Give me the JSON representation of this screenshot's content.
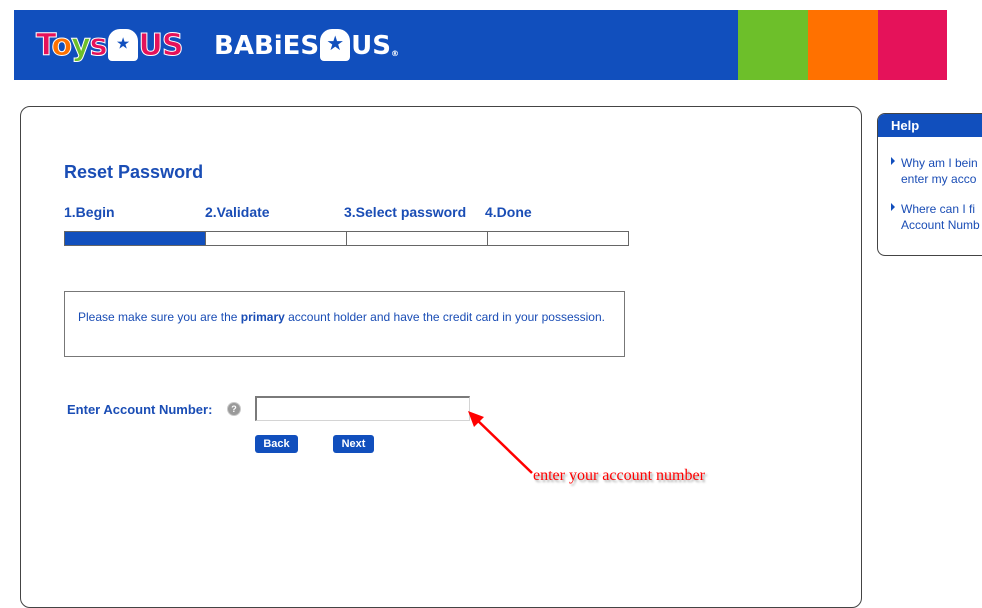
{
  "brand": {
    "toys_logo": {
      "letters": [
        "T",
        "o",
        "y",
        "s"
      ],
      "colors": [
        "#e5125a",
        "#ff7100",
        "#6dbf2a",
        "#e5125a"
      ],
      "r_mark": "★",
      "us": "US",
      "us_color": "#e5125a"
    },
    "babies_logo": {
      "text": "BABiES",
      "r_mark": "★",
      "us": "US",
      "trademark": "®"
    },
    "colors": {
      "primary_blue": "#114fbd",
      "green": "#6dbf2a",
      "orange": "#ff7100",
      "pink": "#e5125a"
    }
  },
  "main": {
    "title": "Reset Password",
    "steps": [
      {
        "label": "1.Begin"
      },
      {
        "label": "2.Validate"
      },
      {
        "label": "3.Select password"
      },
      {
        "label": "4.Done"
      }
    ],
    "progress": {
      "current_step": 1,
      "total_steps": 4
    },
    "notice": {
      "before": "Please make sure you are the ",
      "bold": "primary",
      "after": " account holder and have the credit card in your possession."
    },
    "account_field": {
      "label": "Enter Account Number:",
      "value": "",
      "placeholder": "",
      "help_icon": "?"
    },
    "buttons": {
      "back": "Back",
      "next": "Next"
    }
  },
  "annotation": {
    "text": "enter your account number",
    "color": "#ff0000"
  },
  "help": {
    "title": "Help",
    "items": [
      {
        "line1": "Why am I bein",
        "line2": "enter my acco"
      },
      {
        "line1": "Where can I fi",
        "line2": "Account Numb"
      }
    ]
  }
}
